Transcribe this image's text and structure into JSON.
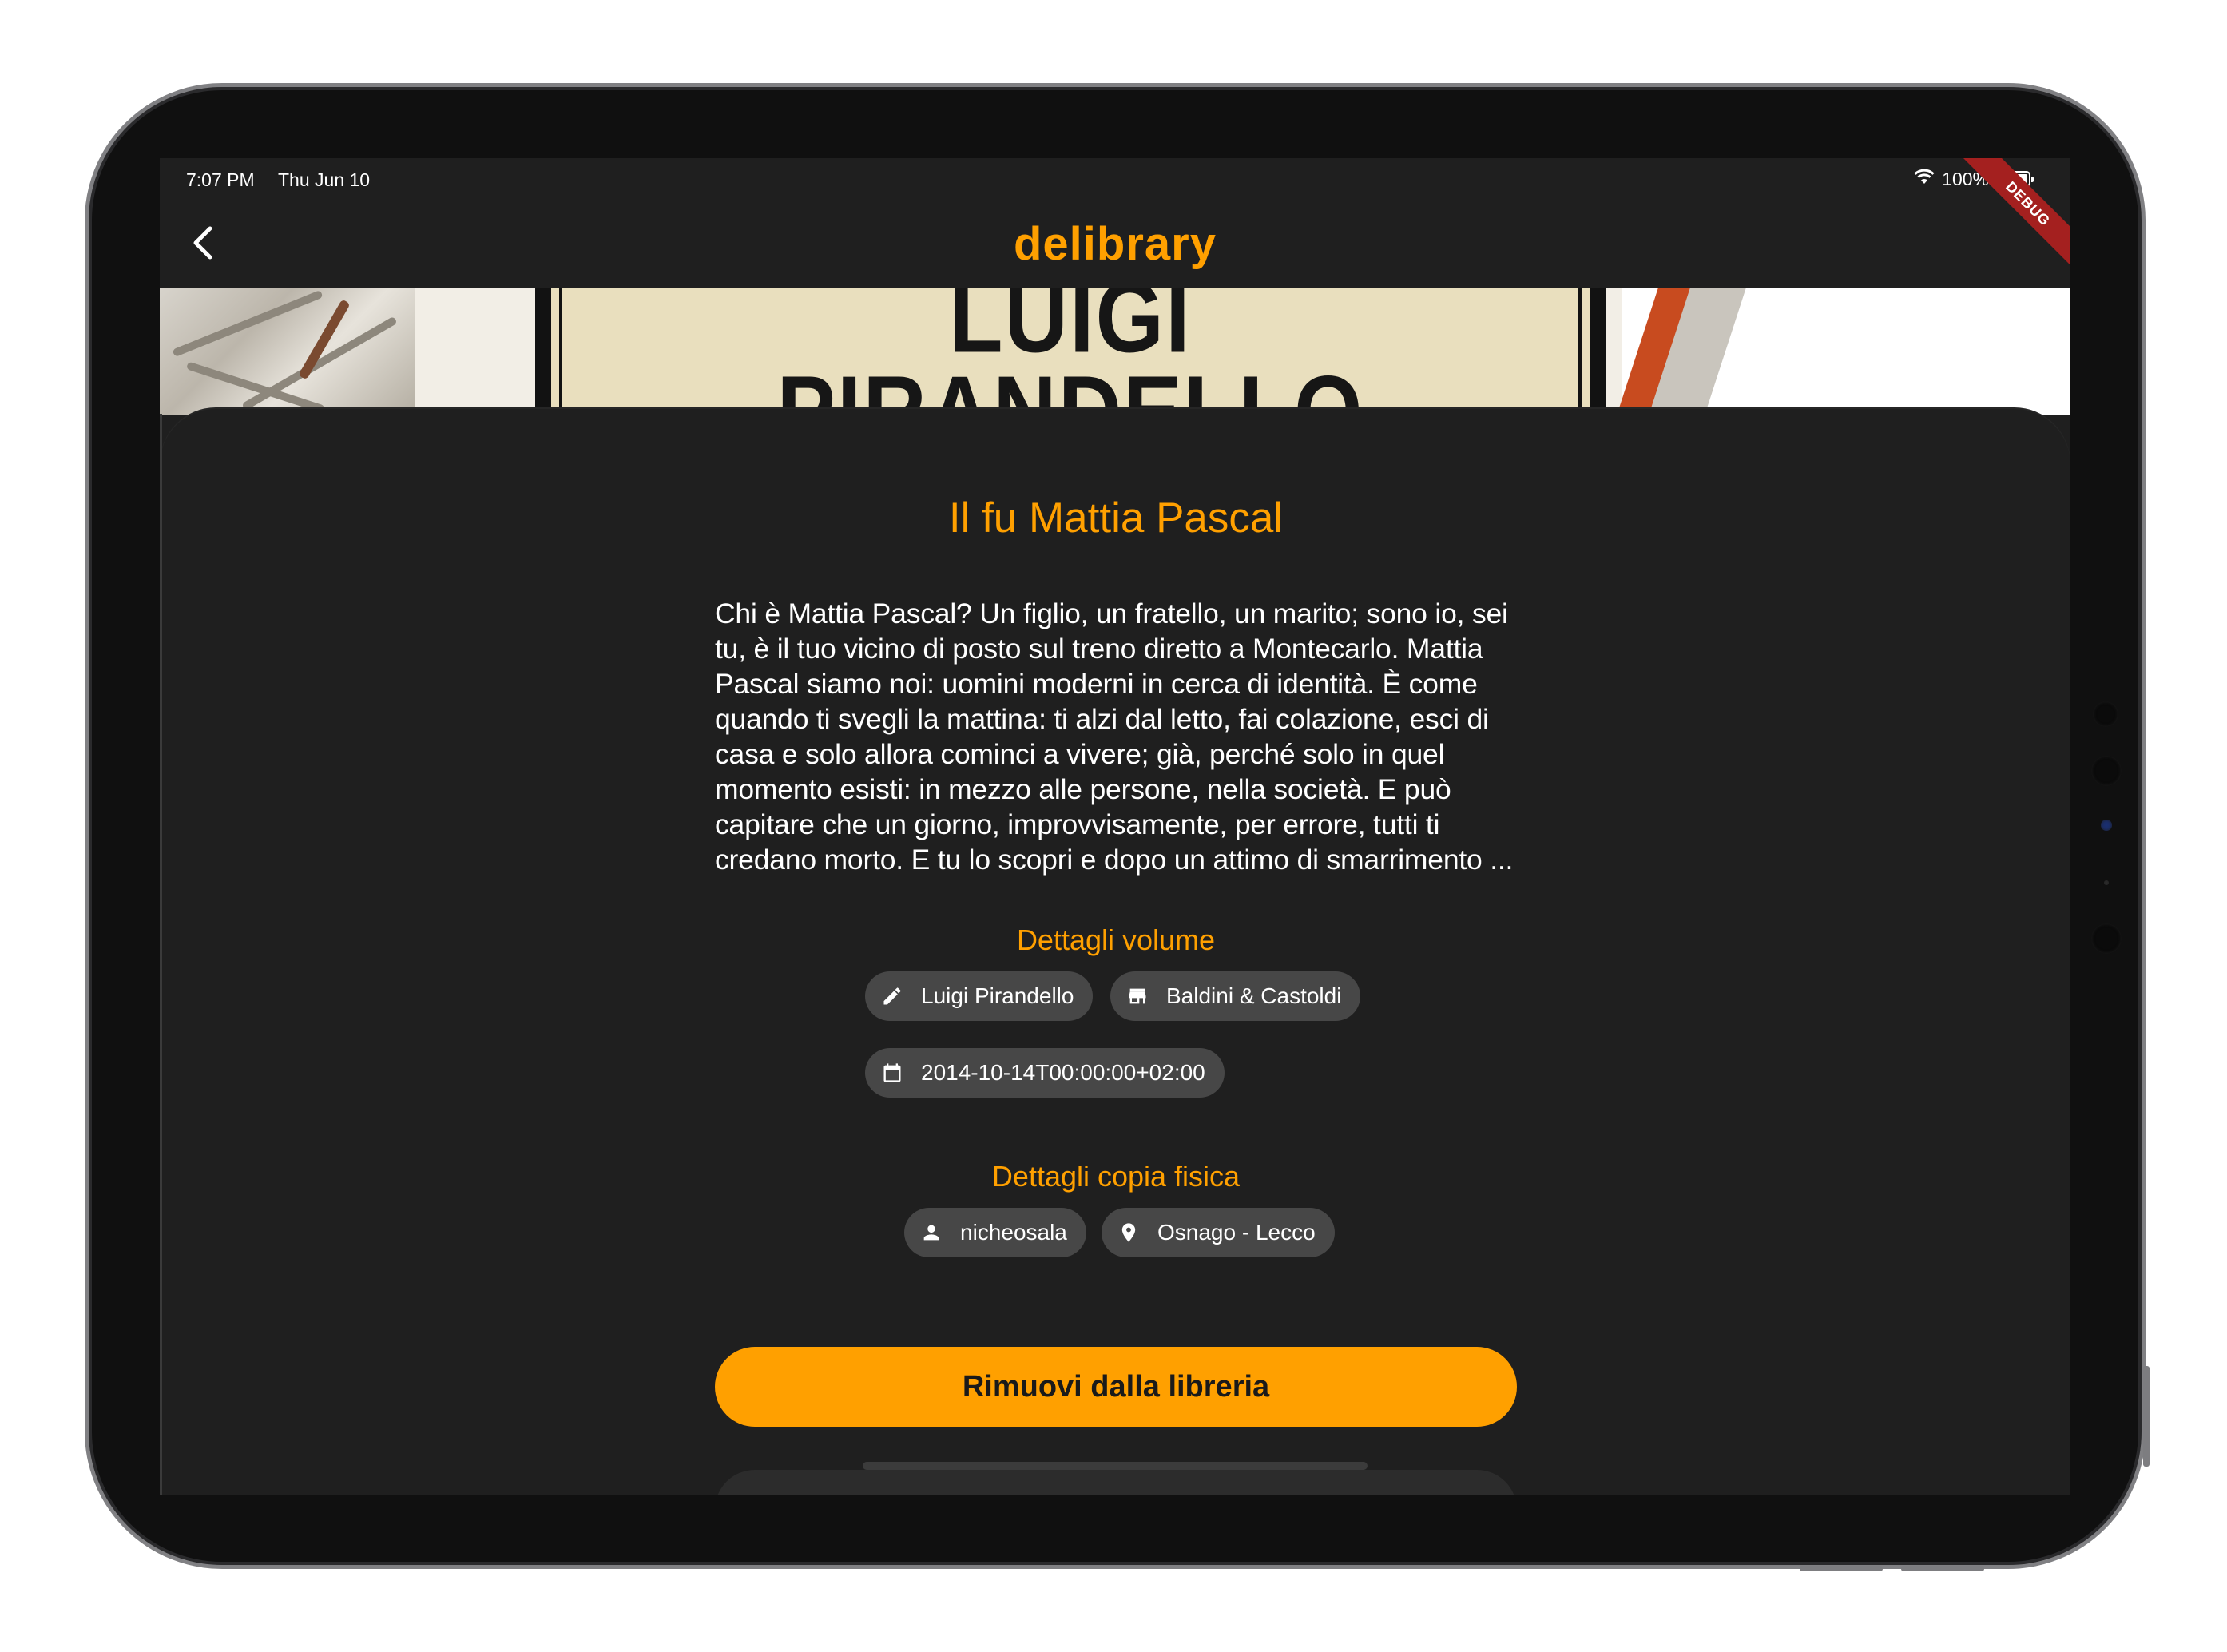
{
  "status_bar": {
    "time": "7:07 PM",
    "date": "Thu Jun 10",
    "battery": "100%",
    "battery_level": 1.0
  },
  "app_bar": {
    "title": "delibrary",
    "back_icon": "chevron-left-icon",
    "debug_banner": "DEBUG"
  },
  "cover": {
    "author_line1": "LUIGI",
    "author_line2": "PIRANDELLO"
  },
  "book": {
    "title": "Il fu Mattia Pascal",
    "description_lines": [
      "Chi è Mattia Pascal? Un figlio, un fratello, un marito; sono io, sei",
      "tu, è il tuo vicino di posto sul treno diretto a Montecarlo. Mattia",
      "Pascal siamo noi: uomini moderni in cerca di identità. È come",
      "quando ti svegli la mattina: ti alzi dal letto, fai colazione, esci di",
      "casa e solo allora cominci a vivere; già, perché solo in quel",
      "momento esisti: in mezzo alle persone, nella società. E può",
      "capitare che un giorno, improvvisamente, per errore, tutti ti",
      "credano morto. E tu lo scopri e dopo un attimo di smarrimento ..."
    ]
  },
  "volume_details": {
    "title": "Dettagli volume",
    "author": {
      "label": "Luigi Pirandello",
      "icon": "pencil-icon"
    },
    "publisher": {
      "label": "Baldini & Castoldi",
      "icon": "store-icon"
    },
    "date": {
      "label": "2014-10-14T00:00:00+02:00",
      "icon": "calendar-icon"
    }
  },
  "copy_details": {
    "title": "Dettagli copia fisica",
    "owner": {
      "label": "nicheosala",
      "icon": "person-icon"
    },
    "location": {
      "label": "Osnago - Lecco",
      "icon": "location-pin-icon"
    }
  },
  "actions": {
    "remove_label": "Rimuovi dalla libreria"
  },
  "colors": {
    "accent": "#ffa000",
    "background": "#1f1f1f",
    "chip": "#474747",
    "text": "#ffffff"
  }
}
